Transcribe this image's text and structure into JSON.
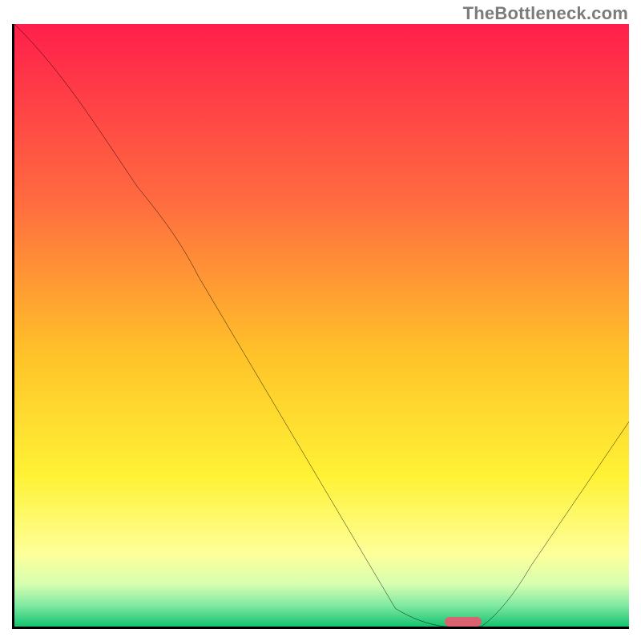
{
  "watermark": "TheBottleneck.com",
  "chart_data": {
    "type": "line",
    "title": "",
    "xlabel": "",
    "ylabel": "",
    "xlim": [
      0,
      100
    ],
    "ylim": [
      0,
      100
    ],
    "x": [
      0,
      20,
      62,
      70,
      76,
      100
    ],
    "values": [
      100,
      73,
      3,
      0,
      0,
      34
    ],
    "background_gradient_stops": [
      {
        "pos": 0.0,
        "color": "#ff1f4b"
      },
      {
        "pos": 0.3,
        "color": "#ff6d3f"
      },
      {
        "pos": 0.55,
        "color": "#ffc329"
      },
      {
        "pos": 0.75,
        "color": "#fff235"
      },
      {
        "pos": 0.88,
        "color": "#fdff9a"
      },
      {
        "pos": 0.93,
        "color": "#d6ffb0"
      },
      {
        "pos": 0.965,
        "color": "#7fe9a2"
      },
      {
        "pos": 1.0,
        "color": "#15c36e"
      }
    ],
    "optimum_marker": {
      "x_start": 70,
      "x_end": 76,
      "y": 0,
      "color": "#d9636f"
    }
  }
}
